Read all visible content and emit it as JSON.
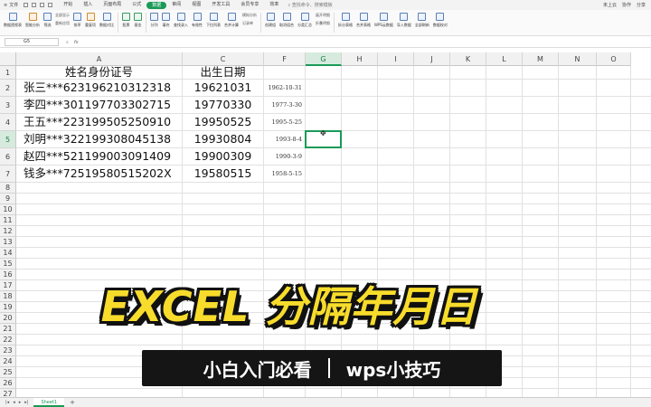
{
  "menubar": {
    "file": "文件",
    "tabs": [
      "开始",
      "插入",
      "页面布局",
      "公式",
      "数据",
      "审阅",
      "视图",
      "开发工具",
      "会员专享",
      "效率"
    ],
    "active_tab": "数据",
    "search": "查找命令、搜索模板",
    "right": [
      "未上云",
      "协作",
      "分享"
    ]
  },
  "ribbon": {
    "buttons": [
      {
        "label": "数据透视表",
        "icon": "pivot-table-icon"
      },
      {
        "label": "智能分析",
        "icon": "smart-analysis-icon"
      },
      {
        "label": "筛选",
        "icon": "filter-icon"
      },
      {
        "label": "排序",
        "icon": "sort-icon"
      },
      {
        "label": "重复项",
        "icon": "duplicates-icon"
      },
      {
        "label": "数据对比",
        "icon": "data-compare-icon"
      },
      {
        "label": "股票",
        "icon": "stock-icon"
      },
      {
        "label": "基金",
        "icon": "fund-icon"
      },
      {
        "label": "分列",
        "icon": "text-to-columns-icon"
      },
      {
        "label": "填充",
        "icon": "fill-icon"
      },
      {
        "label": "查找录入",
        "icon": "lookup-entry-icon"
      },
      {
        "label": "有效性",
        "icon": "validation-icon"
      },
      {
        "label": "下拉列表",
        "icon": "dropdown-list-icon"
      },
      {
        "label": "合并计算",
        "icon": "consolidate-icon"
      },
      {
        "label": "记录单",
        "icon": "record-form-icon"
      },
      {
        "label": "创建组",
        "icon": "group-icon"
      },
      {
        "label": "取消组合",
        "icon": "ungroup-icon"
      },
      {
        "label": "分类汇总",
        "icon": "subtotal-icon"
      },
      {
        "label": "拆分表格",
        "icon": "split-table-icon"
      },
      {
        "label": "合并表格",
        "icon": "merge-table-icon"
      },
      {
        "label": "WPS云数据",
        "icon": "cloud-data-icon"
      },
      {
        "label": "导入数据",
        "icon": "import-data-icon"
      },
      {
        "label": "全部刷新",
        "icon": "refresh-all-icon"
      },
      {
        "label": "数据校对",
        "icon": "proofread-icon"
      }
    ],
    "small": [
      "全部显示",
      "重新应用",
      "模拟分析",
      "展开明细",
      "折叠明细"
    ]
  },
  "formula_bar": {
    "name_box": "G5",
    "fx": "fx",
    "value": ""
  },
  "columns": [
    "A",
    "B",
    "C",
    "D",
    "E",
    "F",
    "G",
    "H",
    "I",
    "J",
    "K",
    "L",
    "M",
    "N",
    "O"
  ],
  "selected_column": "G",
  "selected_row": "5",
  "rows": [
    "1",
    "2",
    "3",
    "4",
    "5",
    "6",
    "7",
    "8",
    "9",
    "10",
    "11",
    "12",
    "13",
    "14",
    "15",
    "16",
    "17",
    "18",
    "19",
    "20",
    "21",
    "22",
    "23",
    "24",
    "25",
    "26",
    "27"
  ],
  "sheet": {
    "header_a": "姓名身份证号",
    "header_c": "出生日期",
    "header_f": "F",
    "records": [
      {
        "a": "张三***623196210312318",
        "c": "19621031",
        "f": "1962-10-31"
      },
      {
        "a": "李四***301197703302715",
        "c": "19770330",
        "f": "1977-3-30"
      },
      {
        "a": "王五***223199505250910",
        "c": "19950525",
        "f": "1995-5-25"
      },
      {
        "a": "刘明***322199308045138",
        "c": "19930804",
        "f": "1993-8-4"
      },
      {
        "a": "赵四***521199003091409",
        "c": "19900309",
        "f": "1990-3-9"
      },
      {
        "a": "钱多***72519580515202X",
        "c": "19580515",
        "f": "1958-5-15"
      }
    ]
  },
  "sheet_tabs": {
    "active": "Sheet1",
    "add": "+"
  },
  "banner": {
    "title": "EXCEL 分隔年月日",
    "sub_left": "小白入门必看",
    "sub_right": "wps小技巧"
  },
  "colors": {
    "accent": "#1a9a57",
    "banner_yellow": "#f8dc2b",
    "banner_black": "#151515"
  }
}
